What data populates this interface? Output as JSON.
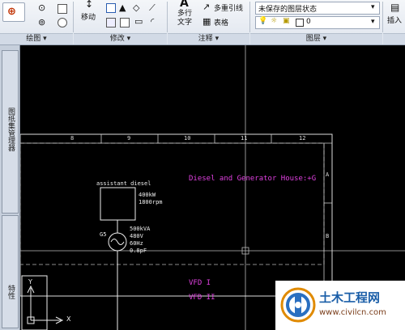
{
  "ribbon": {
    "move_label": "移动",
    "multiline_text_label": "多行\n文字",
    "mleader_label": "多重引线",
    "table_label": "表格",
    "layer_state_value": "未保存的图层状态",
    "layer_current_value": "0",
    "insert_label": "插入",
    "panels": {
      "draw": "绘图",
      "modify": "修改",
      "annotation": "注释",
      "layers": "图层"
    }
  },
  "sidebar": {
    "top_label": "图纸集管理器",
    "bottom_label": "特性"
  },
  "drawing": {
    "ruler_numbers": [
      "8",
      "9",
      "10",
      "11",
      "12"
    ],
    "row_labels": [
      "A",
      "B"
    ],
    "title_text": "Diesel and Generator House:+G",
    "box_label": "assistant diesel",
    "box_specs": [
      "400kW",
      "1800rpm"
    ],
    "generator_label": "G5",
    "generator_specs": [
      "500kVA",
      "480V",
      "60Hz",
      "0.8pF"
    ],
    "vfd_labels": [
      "VFD I",
      "VFD II"
    ],
    "ucs_y": "Y",
    "ucs_x": "X"
  },
  "watermark": {
    "title": "土木工程网",
    "url": "www.civilcn.com"
  },
  "colors": {
    "magenta_text": "#e040e0",
    "watermark_title": "#1a5ea8",
    "watermark_url": "#7a3d1a"
  }
}
